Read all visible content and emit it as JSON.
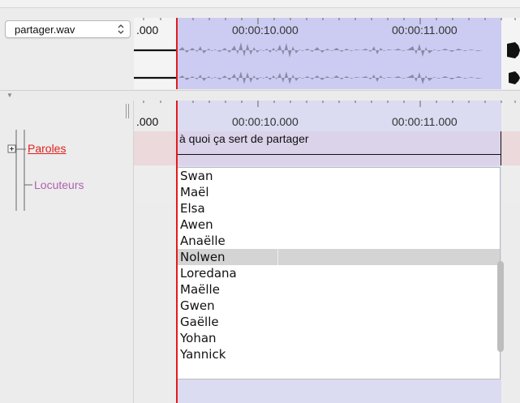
{
  "media": {
    "file_label": "partager.wav"
  },
  "timeline": {
    "left_value": ".000",
    "ticks": [
      "00:00:10.000",
      "00:00:11.000"
    ]
  },
  "tiers": [
    {
      "name": "Paroles",
      "color": "#e02020"
    },
    {
      "name": "Locuteurs",
      "color": "#b060b0"
    }
  ],
  "annotation": {
    "text": "à quoi ça sert de partager"
  },
  "speaker_list": {
    "items": [
      "Swan",
      "Maël",
      "Elsa",
      "Awen",
      "Anaëlle",
      "Nolwen",
      "Loredana",
      "Maëlle",
      "Gwen",
      "Gaëlle",
      "Yohan",
      "Yannick"
    ],
    "selected": "Nolwen"
  },
  "colors": {
    "selection": "#ccccf2",
    "cursor": "#e21b1b",
    "waveform": "#8a8aa8",
    "tier_bg": "#ebd9dc"
  }
}
